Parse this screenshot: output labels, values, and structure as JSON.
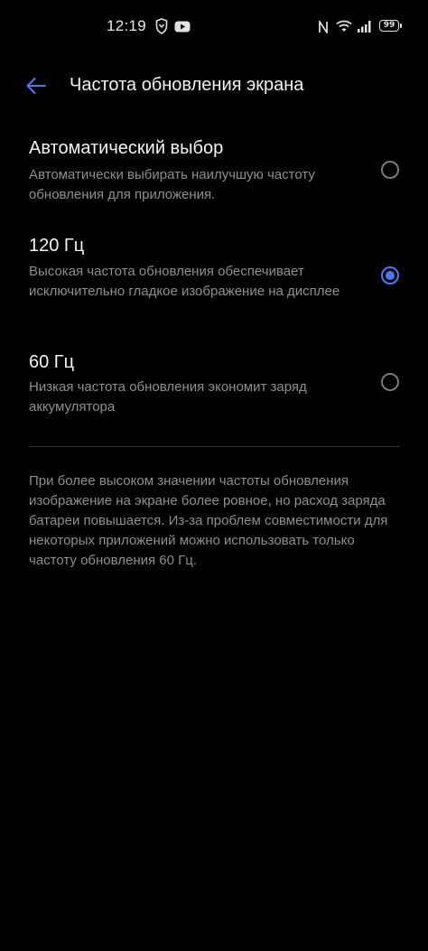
{
  "status_bar": {
    "time": "12:19",
    "battery": "99",
    "icons": [
      "shield-app-icon",
      "youtube-icon",
      "nfc-icon",
      "wifi-icon",
      "signal-icon",
      "battery-icon"
    ]
  },
  "header": {
    "title": "Частота обновления экрана",
    "back_icon": "arrow-left-icon"
  },
  "options": [
    {
      "title": "Автоматический выбор",
      "description": "Автоматически выбирать наилучшую частоту обновления для приложения.",
      "selected": false
    },
    {
      "title": "120 Гц",
      "description": "Высокая частота обновления обеспечивает исключительно гладкое изображение на дисплее",
      "selected": true
    },
    {
      "title": "60 Гц",
      "description": "Низкая частота обновления экономит заряд аккумулятора",
      "selected": false
    }
  ],
  "footnote": "При более высоком значении частоты обновления изображение на экране более ровное, но расход заряда батареи повышается. Из-за проблем совместимости для некоторых приложений можно использовать только частоту обновления 60 Гц.",
  "colors": {
    "accent": "#4d79f4",
    "background": "#000000"
  }
}
